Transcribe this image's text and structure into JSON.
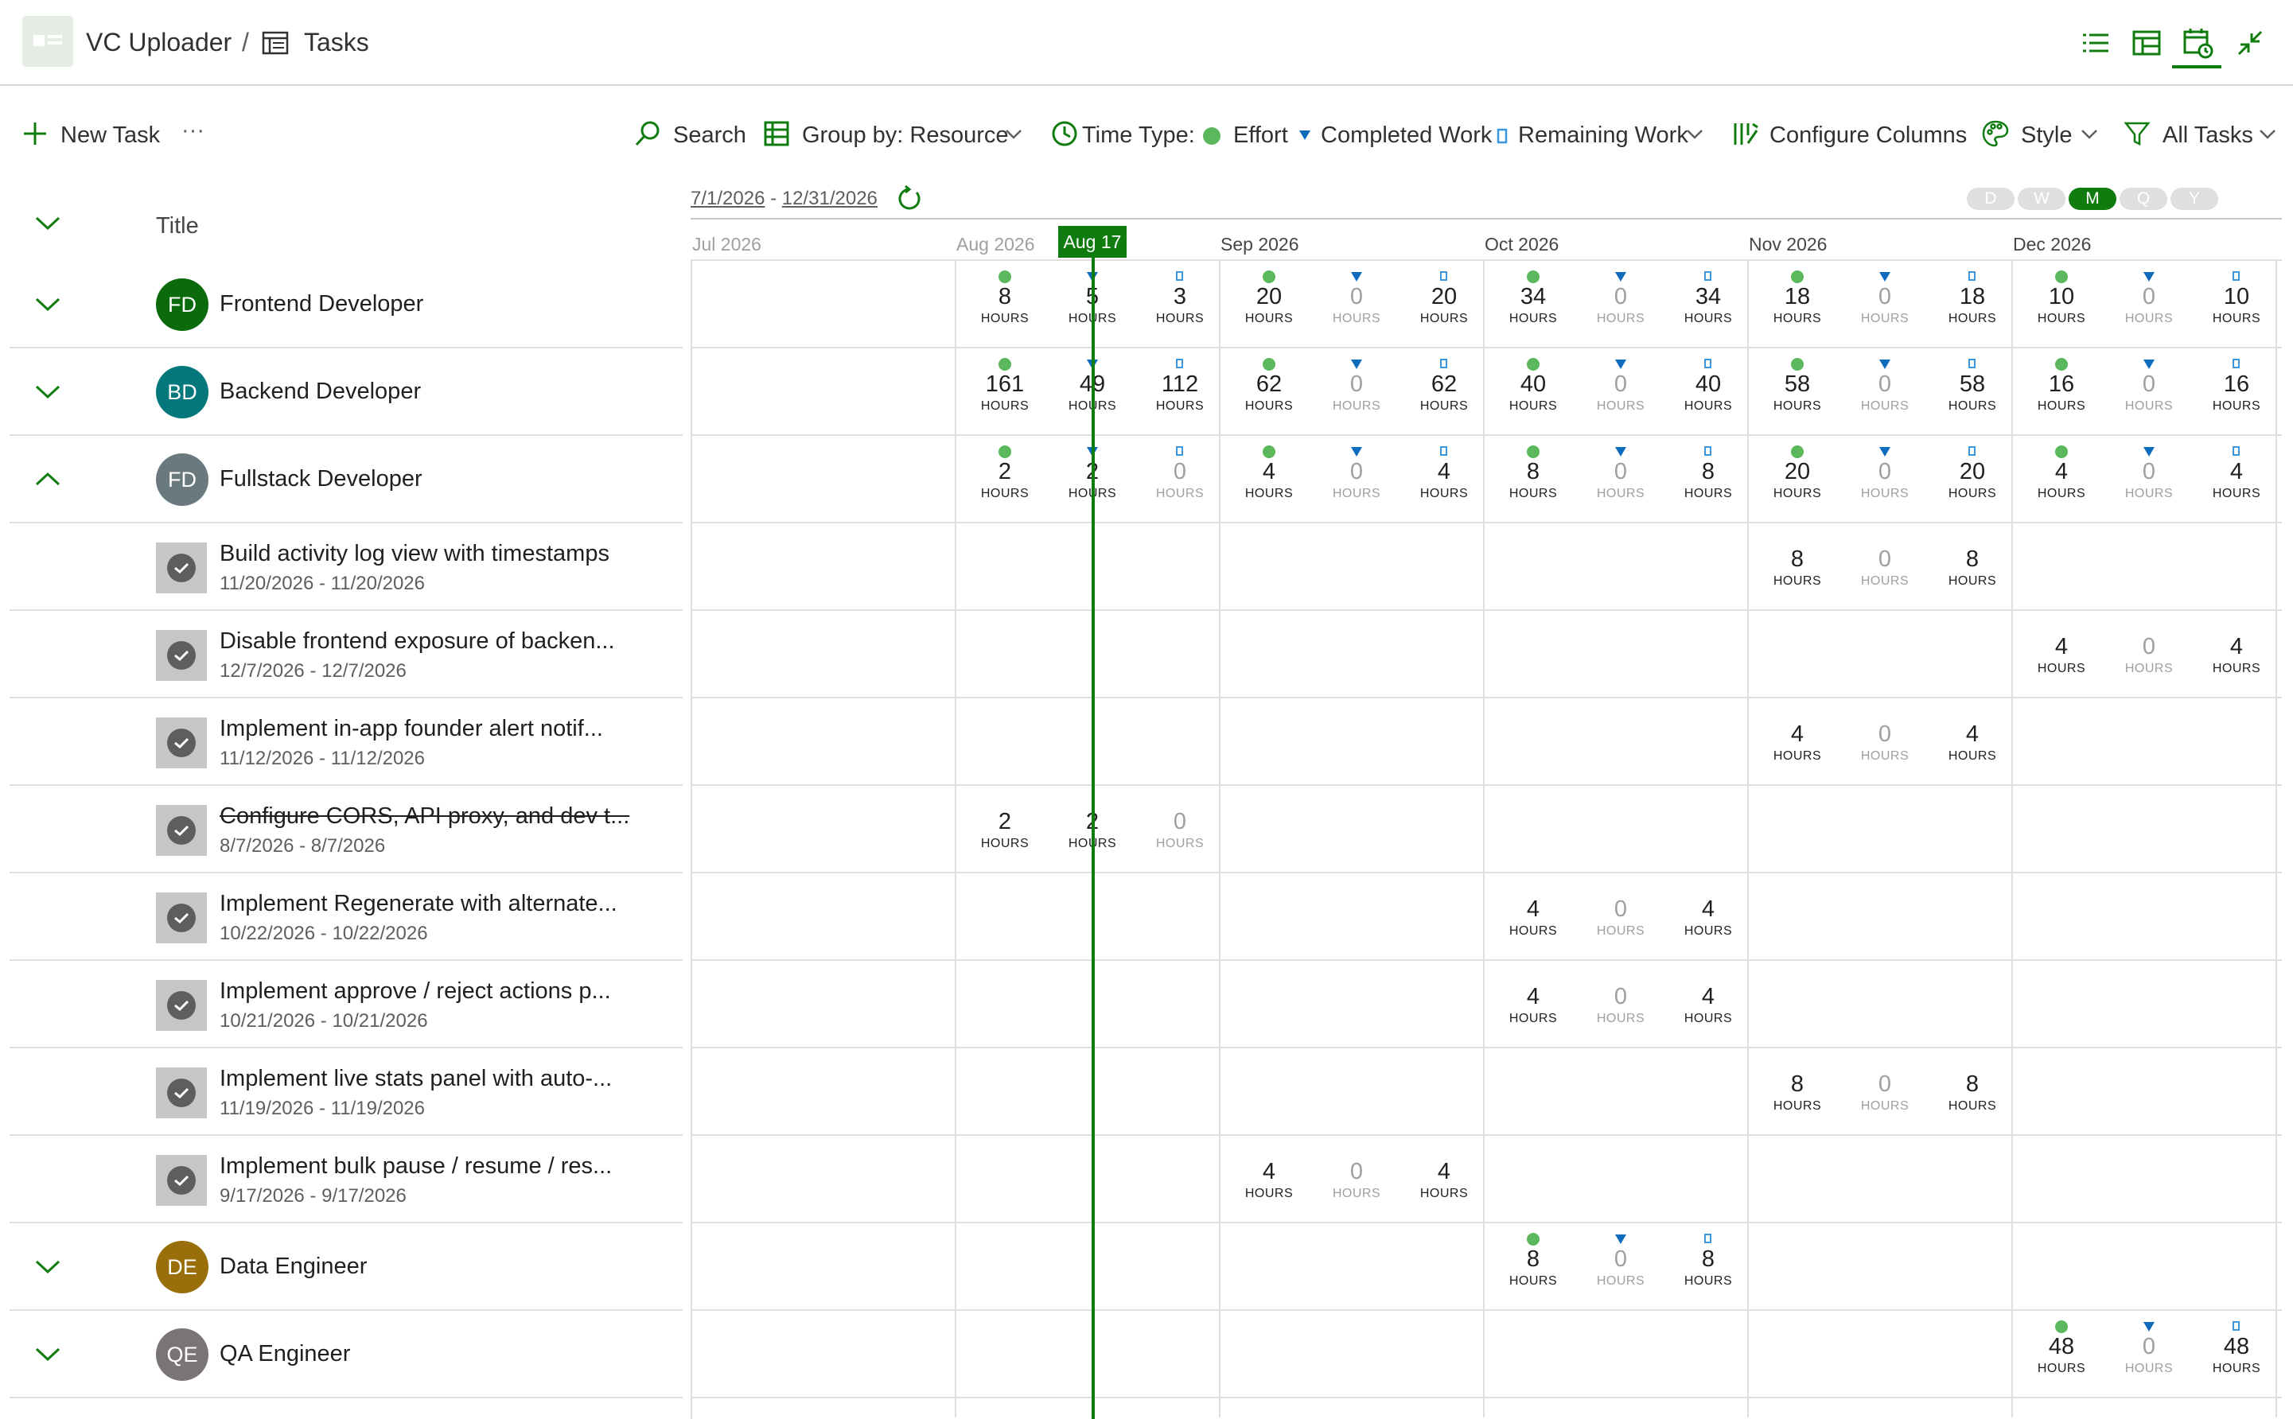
{
  "header": {
    "app_name": "VC Uploader",
    "separator": "/",
    "page_name": "Tasks",
    "icons": [
      "list-view-icon",
      "grid-view-icon",
      "schedule-view-icon",
      "collapse-icon"
    ]
  },
  "toolbar": {
    "new_task": "New Task",
    "more": "···",
    "search": "Search",
    "group_by": "Group by: Resource",
    "time_type_label": "Time Type:",
    "effort": "Effort",
    "completed_work": "Completed Work",
    "remaining_work": "Remaining Work",
    "configure_columns": "Configure Columns",
    "style": "Style",
    "filter": "All Tasks"
  },
  "grid": {
    "title_header": "Title",
    "date_range_start": "7/1/2026",
    "date_range_sep": "-",
    "date_range_end": "12/31/2026",
    "scales": [
      "D",
      "W",
      "M",
      "Q",
      "Y"
    ],
    "active_scale": "M",
    "months": [
      "Jul 2026",
      "Aug 2026",
      "Sep 2026",
      "Oct 2026",
      "Nov 2026",
      "Dec 2026"
    ],
    "today_label": "Aug 17",
    "unit": "HOURS",
    "rows": [
      {
        "type": "resource",
        "initials": "FD",
        "color": "#0b6a0b",
        "name": "Frontend Developer",
        "expanded": false,
        "values": {
          "Aug": [
            8,
            5,
            3
          ],
          "Sep": [
            20,
            0,
            20
          ],
          "Oct": [
            34,
            0,
            34
          ],
          "Nov": [
            18,
            0,
            18
          ],
          "Dec": [
            10,
            0,
            10
          ]
        }
      },
      {
        "type": "resource",
        "initials": "BD",
        "color": "#03787c",
        "name": "Backend Developer",
        "expanded": false,
        "values": {
          "Aug": [
            161,
            49,
            112
          ],
          "Sep": [
            62,
            0,
            62
          ],
          "Oct": [
            40,
            0,
            40
          ],
          "Nov": [
            58,
            0,
            58
          ],
          "Dec": [
            16,
            0,
            16
          ]
        }
      },
      {
        "type": "resource",
        "initials": "FD",
        "color": "#69797e",
        "name": "Fullstack Developer",
        "expanded": true,
        "values": {
          "Aug": [
            2,
            2,
            0
          ],
          "Sep": [
            4,
            0,
            4
          ],
          "Oct": [
            8,
            0,
            8
          ],
          "Nov": [
            20,
            0,
            20
          ],
          "Dec": [
            4,
            0,
            4
          ]
        }
      },
      {
        "type": "task",
        "name": "Build activity log view with timestamps",
        "dates": "11/20/2026 - 11/20/2026",
        "struck": false,
        "values": {
          "Nov": [
            8,
            0,
            8
          ]
        }
      },
      {
        "type": "task",
        "name": "Disable frontend exposure of backen...",
        "dates": "12/7/2026 - 12/7/2026",
        "struck": false,
        "values": {
          "Dec": [
            4,
            0,
            4
          ]
        }
      },
      {
        "type": "task",
        "name": "Implement in-app founder alert notif...",
        "dates": "11/12/2026 - 11/12/2026",
        "struck": false,
        "values": {
          "Nov": [
            4,
            0,
            4
          ]
        }
      },
      {
        "type": "task",
        "name": "Configure CORS, API proxy, and dev t...",
        "dates": "8/7/2026 - 8/7/2026",
        "struck": true,
        "values": {
          "Aug": [
            2,
            2,
            0
          ]
        }
      },
      {
        "type": "task",
        "name": "Implement Regenerate with alternate...",
        "dates": "10/22/2026 - 10/22/2026",
        "struck": false,
        "values": {
          "Oct": [
            4,
            0,
            4
          ]
        }
      },
      {
        "type": "task",
        "name": "Implement approve / reject actions p...",
        "dates": "10/21/2026 - 10/21/2026",
        "struck": false,
        "values": {
          "Oct": [
            4,
            0,
            4
          ]
        }
      },
      {
        "type": "task",
        "name": "Implement live stats panel with auto-...",
        "dates": "11/19/2026 - 11/19/2026",
        "struck": false,
        "values": {
          "Nov": [
            8,
            0,
            8
          ]
        }
      },
      {
        "type": "task",
        "name": "Implement bulk pause / resume / res...",
        "dates": "9/17/2026 - 9/17/2026",
        "struck": false,
        "values": {
          "Sep": [
            4,
            0,
            4
          ]
        }
      },
      {
        "type": "resource",
        "initials": "DE",
        "color": "#986f0b",
        "name": "Data Engineer",
        "expanded": false,
        "values": {
          "Oct": [
            8,
            0,
            8
          ]
        }
      },
      {
        "type": "resource",
        "initials": "QE",
        "color": "#7a7574",
        "name": "QA Engineer",
        "expanded": false,
        "values": {
          "Dec": [
            48,
            0,
            48
          ]
        }
      }
    ]
  },
  "colors": {
    "accent": "#107c10",
    "effort": "#5cb85c",
    "completed": "#0f6cbd",
    "remaining": "#3a96dd"
  }
}
